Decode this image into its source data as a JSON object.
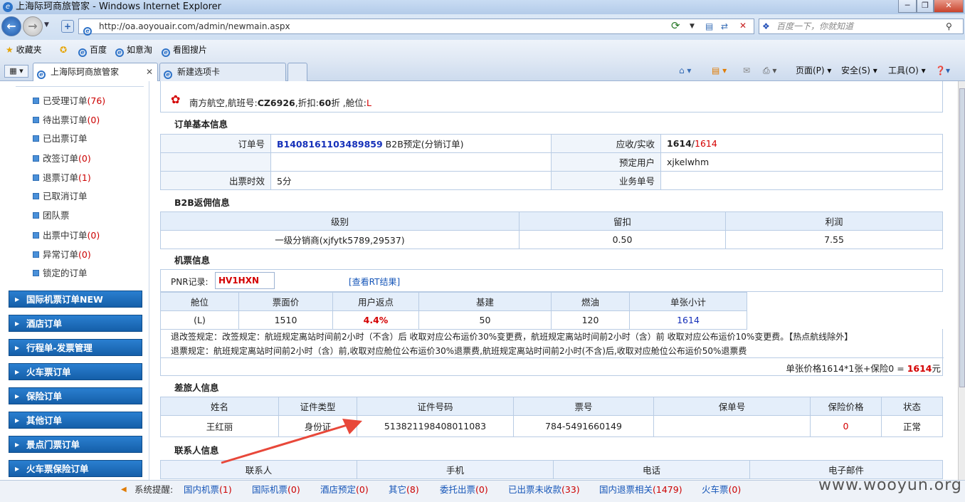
{
  "window": {
    "title": "上海际珂商旅管家 - Windows Internet Explorer"
  },
  "address": {
    "url": "http://oa.aoyouair.com/admin/newmain.aspx",
    "search_placeholder": "百度一下，你就知道"
  },
  "favorites": {
    "label": "收藏夹",
    "items": [
      "百度",
      "如意淘",
      "看图搜片"
    ]
  },
  "tabs": [
    {
      "label": "上海际珂商旅管家"
    },
    {
      "label": "新建选项卡"
    }
  ],
  "toolbar": {
    "page": "页面(P)",
    "safety": "安全(S)",
    "tools": "工具(O)"
  },
  "sidebar": {
    "items": [
      {
        "label": "已受理订单",
        "count": "(76)"
      },
      {
        "label": "待出票订单",
        "count": "(0)"
      },
      {
        "label": "已出票订单",
        "count": ""
      },
      {
        "label": "改签订单",
        "count": "(0)"
      },
      {
        "label": "退票订单",
        "count": "(1)"
      },
      {
        "label": "已取消订单",
        "count": ""
      },
      {
        "label": "团队票",
        "count": ""
      },
      {
        "label": "出票中订单",
        "count": "(0)"
      },
      {
        "label": "异常订单",
        "count": "(0)"
      },
      {
        "label": "锁定的订单",
        "count": ""
      }
    ],
    "menus": [
      "国际机票订单NEW",
      "酒店订单",
      "行程单-发票管理",
      "火车票订单",
      "保险订单",
      "其他订单",
      "景点门票订单",
      "火车票保险订单"
    ]
  },
  "flight": {
    "airline": "南方航空,航班号:",
    "flight_no": "CZ6926",
    "discount_label": ",折扣:",
    "discount": "60",
    "discount_unit": "折",
    "cabin_label": " ,舱位:",
    "cabin": "L"
  },
  "order_basic": {
    "section": "订单基本信息",
    "order_no_label": "订单号",
    "order_no": "B1408161103489859",
    "order_type": " B2B预定(分销订单)",
    "amount_label": "应收/实收",
    "amount_recv": "1614",
    "amount_sep": "/",
    "amount_actual": "1614",
    "booker_label": "预定用户",
    "booker": "xjkelwhm",
    "ticket_time_label": "出票时效",
    "ticket_time": "5分",
    "biz_no_label": "业务单号"
  },
  "b2b": {
    "section": "B2B返佣信息",
    "headers": [
      "级别",
      "留扣",
      "利润"
    ],
    "row": [
      "一级分销商(xjfytk5789,29537)",
      "0.50",
      "7.55"
    ]
  },
  "ticket": {
    "section": "机票信息",
    "pnr_label": "PNR记录:",
    "pnr": "HV1HXN",
    "rt_link": "[查看RT结果]",
    "headers": [
      "舱位",
      "票面价",
      "用户返点",
      "基建",
      "燃油",
      "单张小计"
    ],
    "row": [
      "(L)",
      "1510",
      "4.4%",
      "50",
      "120",
      "1614"
    ],
    "change_rule": "退改签规定：改签规定：航班规定离站时间前2小时（不含）后 收取对应公布运价30%变更费，航班规定离站时间前2小时（含）前 收取对应公布运价10%变更费。【热点航线除外】",
    "refund_rule": "退票规定：航班规定离站时间前2小时（含）前,收取对应舱位公布运价30%退票费,航班规定离站时间前2小时(不含)后,收取对应舱位公布运价50%退票费",
    "total_text": "单张价格1614*1张+保险0 = ",
    "total": "1614",
    "total_unit": "元"
  },
  "passenger": {
    "section": "差旅人信息",
    "headers": [
      "姓名",
      "证件类型",
      "证件号码",
      "票号",
      "保单号",
      "保险价格",
      "状态"
    ],
    "row": [
      "王红丽",
      "身份证",
      "513821198408011083",
      "784-5491660149",
      "",
      "0",
      "正常"
    ]
  },
  "contact": {
    "section": "联系人信息",
    "headers": [
      "联系人",
      "手机",
      "电话",
      "电子邮件"
    ]
  },
  "status": {
    "label": "系统提醒:",
    "links": [
      {
        "label": "国内机票",
        "count": "(1)"
      },
      {
        "label": "国际机票",
        "count": "(0)"
      },
      {
        "label": "酒店预定",
        "count": "(0)"
      },
      {
        "label": "其它",
        "count": "(8)"
      },
      {
        "label": "委托出票",
        "count": "(0)"
      },
      {
        "label": "已出票未收款",
        "count": "(33)"
      },
      {
        "label": "国内退票相关",
        "count": "(1479)"
      },
      {
        "label": "火车票",
        "count": "(0)"
      }
    ],
    "watermark": "www.wooyun.org"
  }
}
